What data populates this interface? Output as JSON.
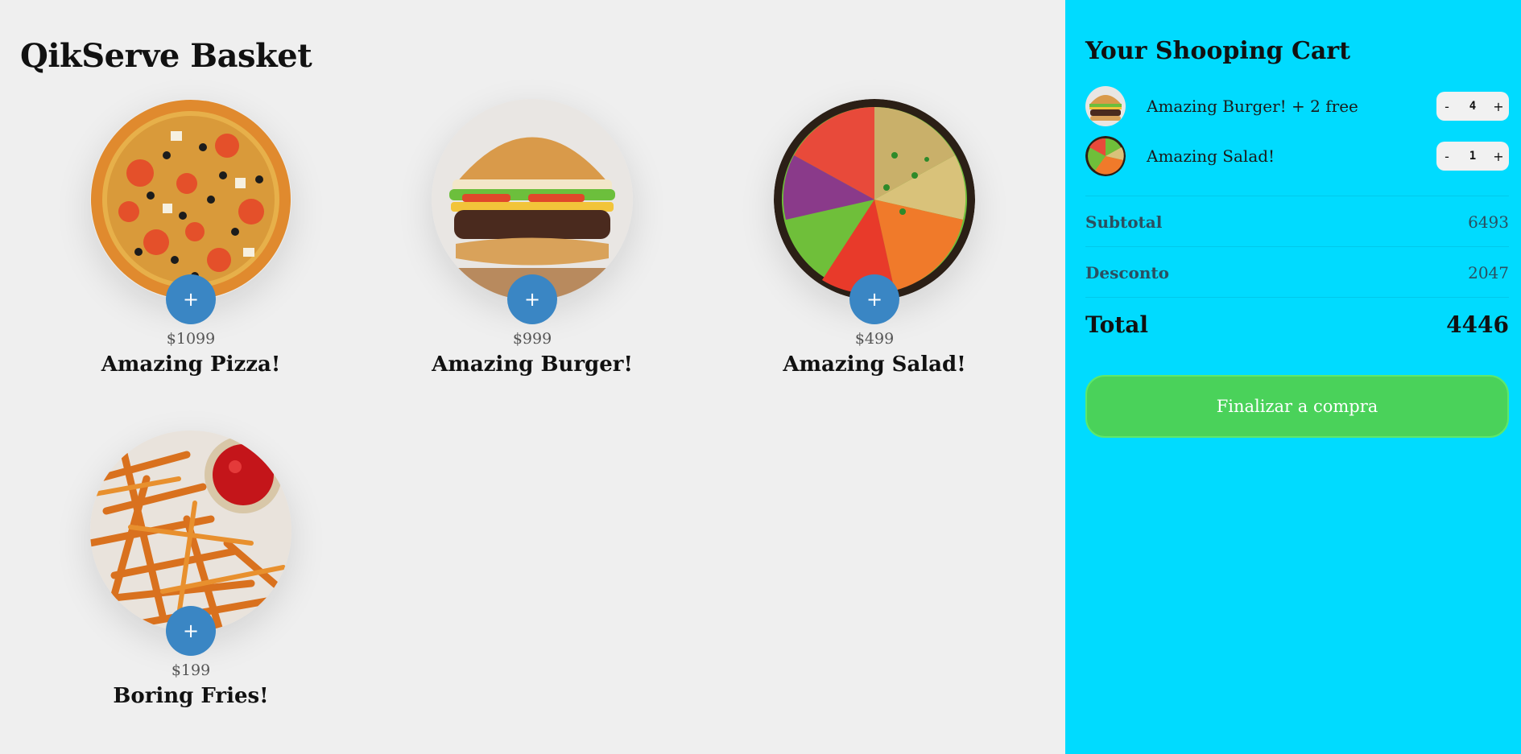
{
  "store": {
    "title": "QikServe Basket",
    "add_label": "+",
    "products": [
      {
        "name": "Amazing Pizza!",
        "price": "$1099",
        "image": "pizza-image"
      },
      {
        "name": "Amazing Burger!",
        "price": "$999",
        "image": "burger-image"
      },
      {
        "name": "Amazing Salad!",
        "price": "$499",
        "image": "salad-image"
      },
      {
        "name": "Boring Fries!",
        "price": "$199",
        "image": "fries-image"
      }
    ]
  },
  "cart": {
    "title": "Your Shooping Cart",
    "items": [
      {
        "name": "Amazing Burger! + 2 free",
        "qty": "4",
        "minus": "-",
        "plus": "+",
        "image": "burger-thumbnail"
      },
      {
        "name": "Amazing Salad!",
        "qty": "1",
        "minus": "-",
        "plus": "+",
        "image": "salad-thumbnail"
      }
    ],
    "subtotal_label": "Subtotal",
    "subtotal_value": "6493",
    "discount_label": "Desconto",
    "discount_value": "2047",
    "total_label": "Total",
    "total_value": "4446",
    "checkout_label": "Finalizar a compra"
  },
  "colors": {
    "store_background": "#efefef",
    "cart_background": "#00dbff",
    "add_button": "#3a86c4",
    "checkout_button": "#4ad25a"
  }
}
